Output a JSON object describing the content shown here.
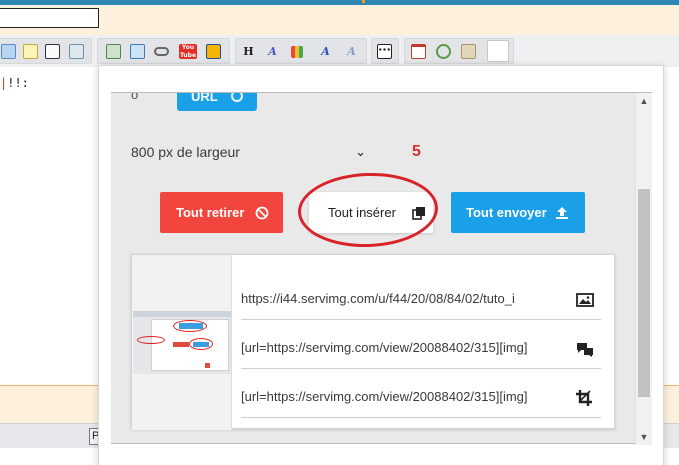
{
  "editor": {
    "body_text": "!!:",
    "bottom_button_label": "P"
  },
  "toolbar": {
    "icons": [
      "preview-icon",
      "note-icon",
      "edit-icon",
      "table-icon",
      "image-icon",
      "upload-image-icon",
      "link-icon",
      "youtube-icon",
      "flash-icon",
      "heading-icon",
      "font-size-icon",
      "color-icon",
      "font-icon",
      "font-style-icon",
      "more-icon",
      "calendar-icon",
      "time-icon",
      "paste-icon",
      "document-icon"
    ],
    "heading_label": "H",
    "youtube_label": "You Tube"
  },
  "upload": {
    "partial_label": "o",
    "url_chip_label": "URL",
    "size_option": "800 px de largeur",
    "step_number": "5",
    "remove_all_label": "Tout retirer",
    "insert_all_label": "Tout insérer",
    "send_all_label": "Tout envoyer",
    "links": [
      {
        "text": "https://i44.servimg.com/u/f44/20/08/84/02/tuto_i",
        "icon": "image-icon"
      },
      {
        "text": "[url=https://servimg.com/view/20088402/315][img]",
        "icon": "forum-bbcode-icon"
      },
      {
        "text": "[url=https://servimg.com/view/20088402/315][img]",
        "icon": "crop-icon"
      }
    ]
  },
  "colors": {
    "remove_button": "#f2453d",
    "send_button": "#1aa0e8",
    "annotation": "#d8232a"
  }
}
